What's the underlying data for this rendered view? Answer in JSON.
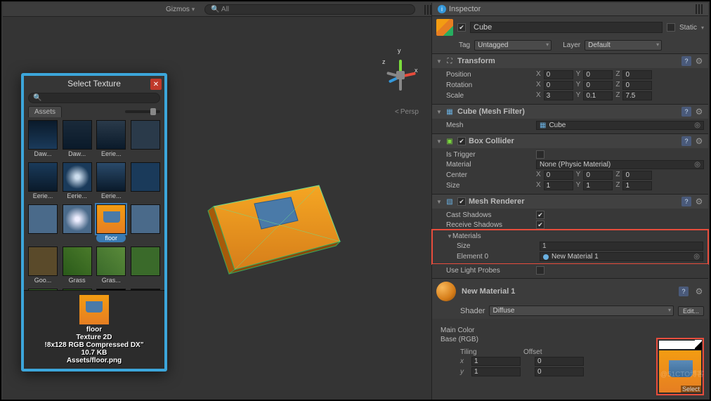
{
  "scene_toolbar": {
    "gizmos_label": "Gizmos",
    "search_placeholder": "All"
  },
  "scene": {
    "projection": "Persp",
    "axis_labels": {
      "x": "x",
      "y": "y",
      "z": "z"
    }
  },
  "inspector": {
    "title": "Inspector",
    "object_enabled": true,
    "object_name": "Cube",
    "static_label": "Static",
    "tag_label": "Tag",
    "tag_value": "Untagged",
    "layer_label": "Layer",
    "layer_value": "Default",
    "transform": {
      "title": "Transform",
      "position": {
        "label": "Position",
        "x": "0",
        "y": "0",
        "z": "0"
      },
      "rotation": {
        "label": "Rotation",
        "x": "0",
        "y": "0",
        "z": "0"
      },
      "scale": {
        "label": "Scale",
        "x": "3",
        "y": "0.1",
        "z": "7.5"
      }
    },
    "mesh_filter": {
      "title": "Cube (Mesh Filter)",
      "mesh_label": "Mesh",
      "mesh_value": "Cube"
    },
    "box_collider": {
      "title": "Box Collider",
      "enabled": true,
      "is_trigger_label": "Is Trigger",
      "is_trigger": false,
      "material_label": "Material",
      "material_value": "None (Physic Material)",
      "center": {
        "label": "Center",
        "x": "0",
        "y": "0",
        "z": "0"
      },
      "size": {
        "label": "Size",
        "x": "1",
        "y": "1",
        "z": "1"
      }
    },
    "mesh_renderer": {
      "title": "Mesh Renderer",
      "enabled": true,
      "cast_shadows_label": "Cast Shadows",
      "cast_shadows": true,
      "receive_shadows_label": "Receive Shadows",
      "receive_shadows": true,
      "materials_label": "Materials",
      "size_label": "Size",
      "size_value": "1",
      "element0_label": "Element 0",
      "element0_value": "New Material 1",
      "use_light_probes_label": "Use Light Probes",
      "use_light_probes": false
    },
    "material": {
      "name": "New Material 1",
      "shader_label": "Shader",
      "shader_value": "Diffuse",
      "edit_label": "Edit...",
      "main_color_label": "Main Color",
      "base_label": "Base (RGB)",
      "tiling_label": "Tiling",
      "offset_label": "Offset",
      "x_label": "x",
      "y_label": "y",
      "tiling_x": "1",
      "tiling_y": "1",
      "offset_x": "0",
      "offset_y": "0",
      "select_label": "Select"
    }
  },
  "select_texture": {
    "title": "Select Texture",
    "search_value": "",
    "tab": "Assets",
    "items": [
      {
        "name": "Daw..."
      },
      {
        "name": "Daw..."
      },
      {
        "name": "Eerie..."
      },
      {
        "name": ""
      },
      {
        "name": "Eerie..."
      },
      {
        "name": "Eerie..."
      },
      {
        "name": "Eerie..."
      },
      {
        "name": ""
      },
      {
        "name": ""
      },
      {
        "name": ""
      },
      {
        "name": "floor",
        "selected": true
      },
      {
        "name": ""
      },
      {
        "name": "Goo..."
      },
      {
        "name": "Grass"
      },
      {
        "name": "Gras..."
      },
      {
        "name": ""
      },
      {
        "name": ""
      },
      {
        "name": ""
      },
      {
        "name": ""
      },
      {
        "name": ""
      }
    ],
    "info": {
      "line1": "floor",
      "line2": "Texture 2D",
      "line3": "!8x128  RGB Compressed DX\"",
      "line4": "10.7 KB",
      "line5": "Assets/floor.png"
    }
  },
  "watermark": "@51CTO博客"
}
